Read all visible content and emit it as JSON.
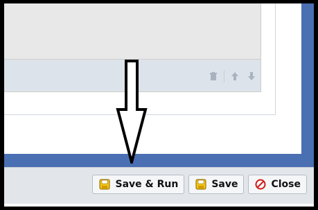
{
  "footer": {
    "buttons": [
      {
        "label": "Save & Run",
        "icon": "floppy-disk-icon"
      },
      {
        "label": "Save",
        "icon": "floppy-disk-icon"
      },
      {
        "label": "Close",
        "icon": "no-entry-icon"
      }
    ]
  },
  "toolbar": {
    "icons": [
      "trash-icon",
      "arrow-up-icon",
      "arrow-down-icon"
    ]
  },
  "colors": {
    "window_blue": "#4a6fb3",
    "panel_gray": "#e8e8e8",
    "toolbar_blue_gray": "#dde3ea",
    "footer_gray": "#e2e6ea",
    "close_red": "#d11b1b",
    "floppy_yellow": "#f0c419"
  }
}
